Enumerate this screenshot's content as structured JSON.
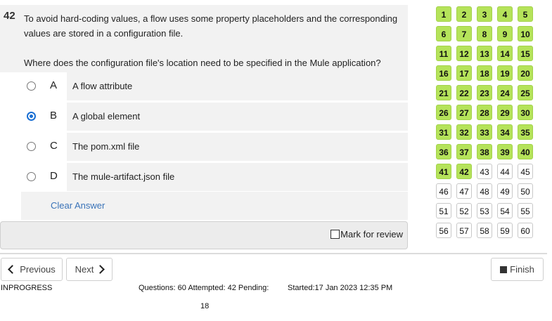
{
  "question": {
    "number": "42",
    "text_line1": "To avoid hard-coding values, a flow uses some property placeholders and the corresponding",
    "text_line2": "values are stored in a configuration file.",
    "text_line3": "Where does the configuration file's location need to be specified in the Mule application?"
  },
  "options": [
    {
      "letter": "A",
      "text": "A flow attribute",
      "selected": false
    },
    {
      "letter": "B",
      "text": "A global element",
      "selected": true
    },
    {
      "letter": "C",
      "text": "The pom.xml file",
      "selected": false
    },
    {
      "letter": "D",
      "text": "The mule-artifact.json file",
      "selected": false
    }
  ],
  "clear_answer": "Clear Answer",
  "mark_for_review": "Mark for review",
  "grid": {
    "numbers": [
      "1",
      "2",
      "3",
      "4",
      "5",
      "6",
      "7",
      "8",
      "9",
      "10",
      "11",
      "12",
      "13",
      "14",
      "15",
      "16",
      "17",
      "18",
      "19",
      "20",
      "21",
      "22",
      "23",
      "24",
      "25",
      "26",
      "27",
      "28",
      "29",
      "30",
      "31",
      "32",
      "33",
      "34",
      "35",
      "36",
      "37",
      "38",
      "39",
      "40",
      "41",
      "42",
      "43",
      "44",
      "45",
      "46",
      "47",
      "48",
      "49",
      "50",
      "51",
      "52",
      "53",
      "54",
      "55",
      "56",
      "57",
      "58",
      "59",
      "60"
    ],
    "attempted_count": 42,
    "attempted_color": "#b5e35a"
  },
  "nav": {
    "previous": "Previous",
    "next": "Next",
    "finish": "Finish"
  },
  "status": {
    "state": "INPROGRESS",
    "counts_line": "Questions: 60 Attempted: 42 Pending:",
    "pending": "18",
    "started": "Started:17 Jan 2023 12:35 PM"
  }
}
